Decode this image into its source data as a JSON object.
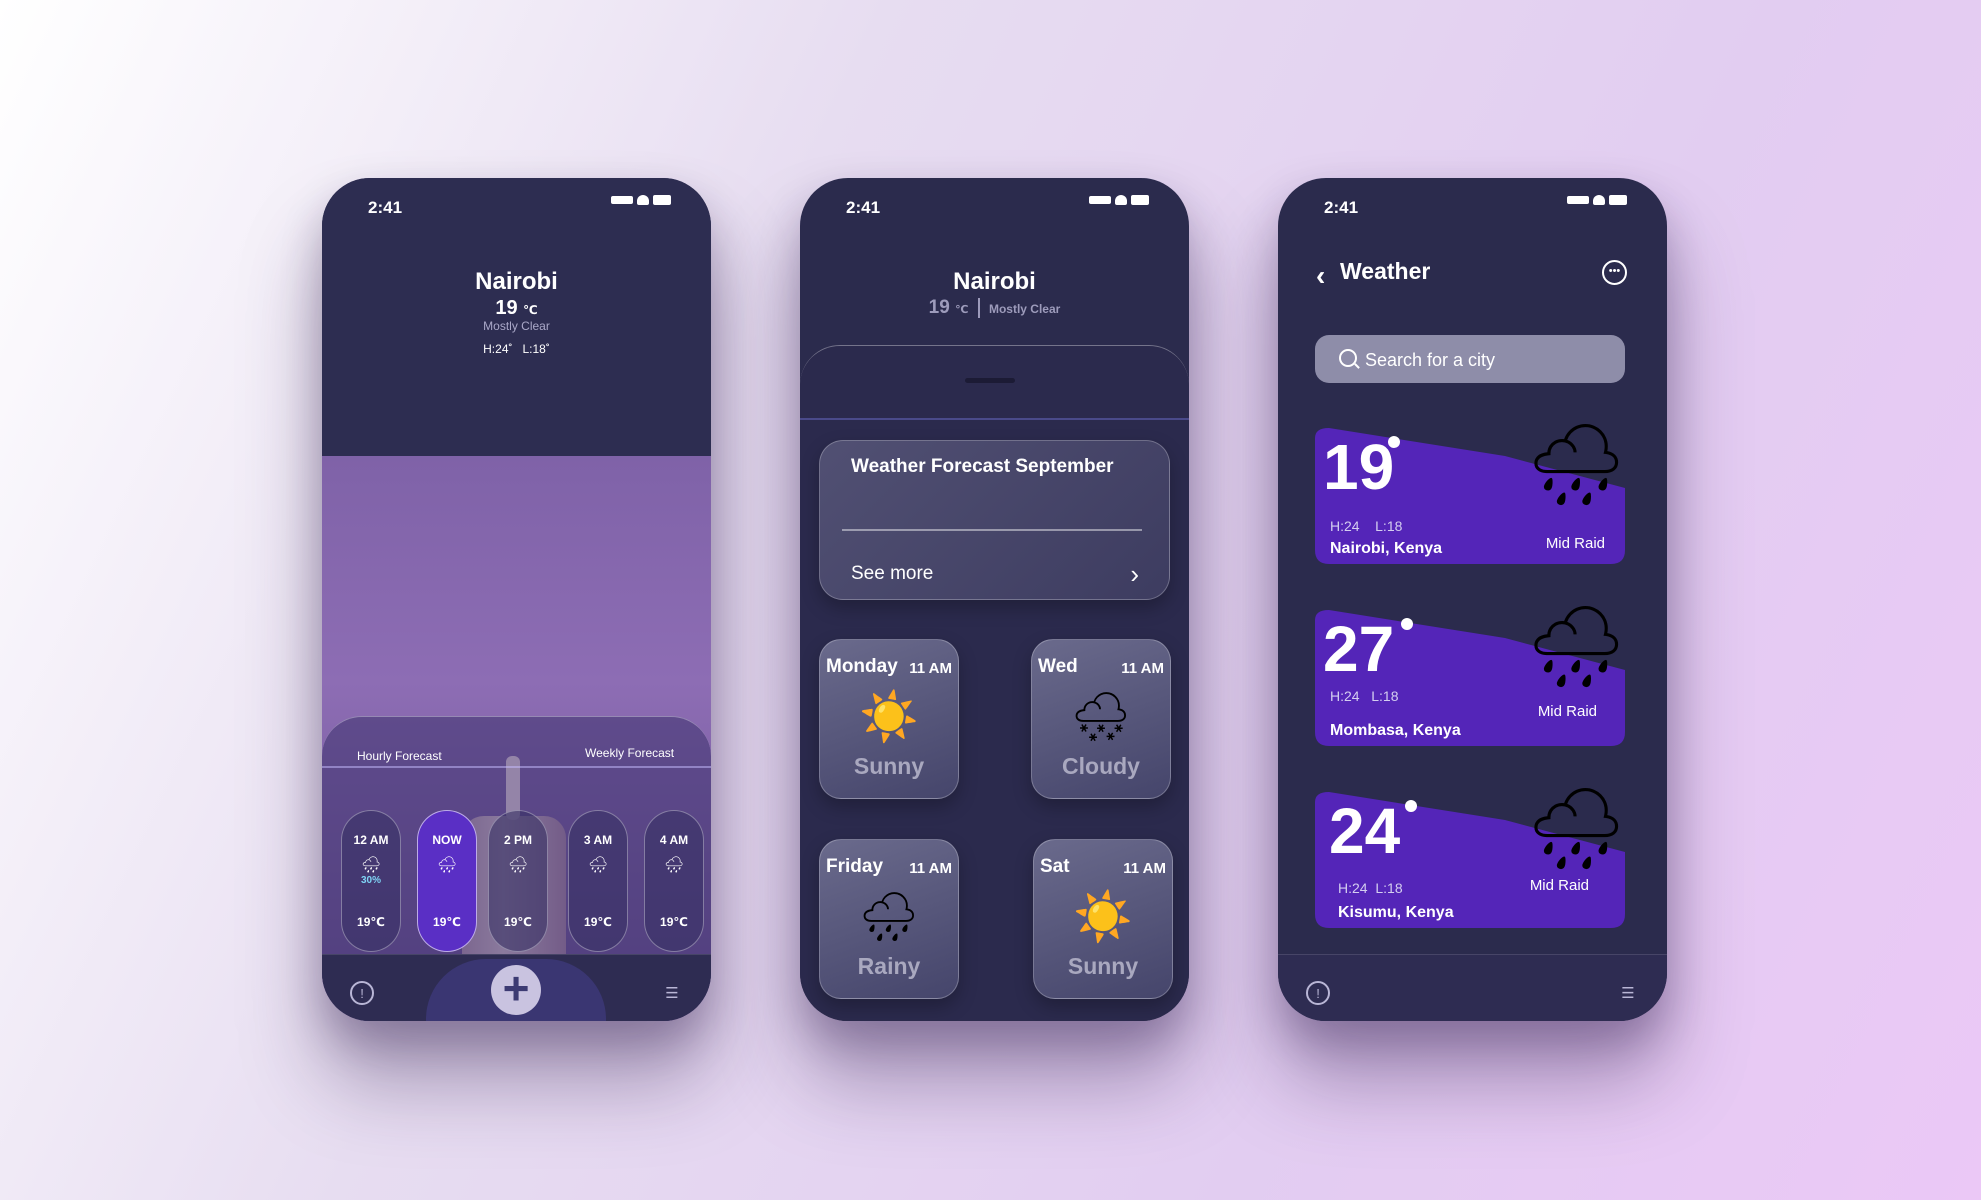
{
  "status": {
    "time": "2:41"
  },
  "phone1": {
    "city": "Nairobi",
    "temp": "19",
    "unit": "℃",
    "condition": "Mostly Clear",
    "high": "H:24˚",
    "low": "L:18˚",
    "tabs": [
      "Hourly Forecast",
      "Weekly Forecast"
    ],
    "hours": [
      {
        "time": "12 AM",
        "icon": "cloud-rain-icon",
        "precip": "30%",
        "temp": "19℃"
      },
      {
        "time": "NOW",
        "icon": "cloud-rain-icon",
        "temp": "19℃"
      },
      {
        "time": "2 PM",
        "icon": "cloud-rain-icon",
        "temp": "19℃"
      },
      {
        "time": "3 AM",
        "icon": "cloud-rain-icon",
        "temp": "19℃"
      },
      {
        "time": "4 AM",
        "icon": "cloud-rain-icon",
        "temp": "19℃"
      }
    ]
  },
  "phone2": {
    "city": "Nairobi",
    "temp": "19",
    "unit": "℃",
    "condition": "Mostly Clear",
    "forecast_title": "Weather Forecast September",
    "see_more": "See more",
    "days": [
      {
        "day": "Monday",
        "time": "11 AM",
        "condition": "Sunny",
        "icon": "sun-icon"
      },
      {
        "day": "Wed",
        "time": "11 AM",
        "condition": "Cloudy",
        "icon": "cloud-snow-icon"
      },
      {
        "day": "Friday",
        "time": "11 AM",
        "condition": "Rainy",
        "icon": "cloud-rain-icon"
      },
      {
        "day": "Sat",
        "time": "11 AM",
        "condition": "Sunny",
        "icon": "sun-icon"
      }
    ]
  },
  "phone3": {
    "title": "Weather",
    "search_placeholder": "Search for a city",
    "cities": [
      {
        "temp": "19",
        "high": "H:24",
        "low": "L:18",
        "name": "Nairobi, Kenya",
        "condition": "Mid Raid"
      },
      {
        "temp": "27",
        "high": "H:24",
        "low": "L:18",
        "name": "Mombasa, Kenya",
        "condition": "Mid Raid"
      },
      {
        "temp": "24",
        "high": "H:24",
        "low": "L:18",
        "name": "Kisumu, Kenya",
        "condition": "Mid Raid"
      }
    ]
  },
  "colors": {
    "accent": "#5a2fc5",
    "card_purple": "#5425b8",
    "phone_bg": "#2b2b4d"
  }
}
